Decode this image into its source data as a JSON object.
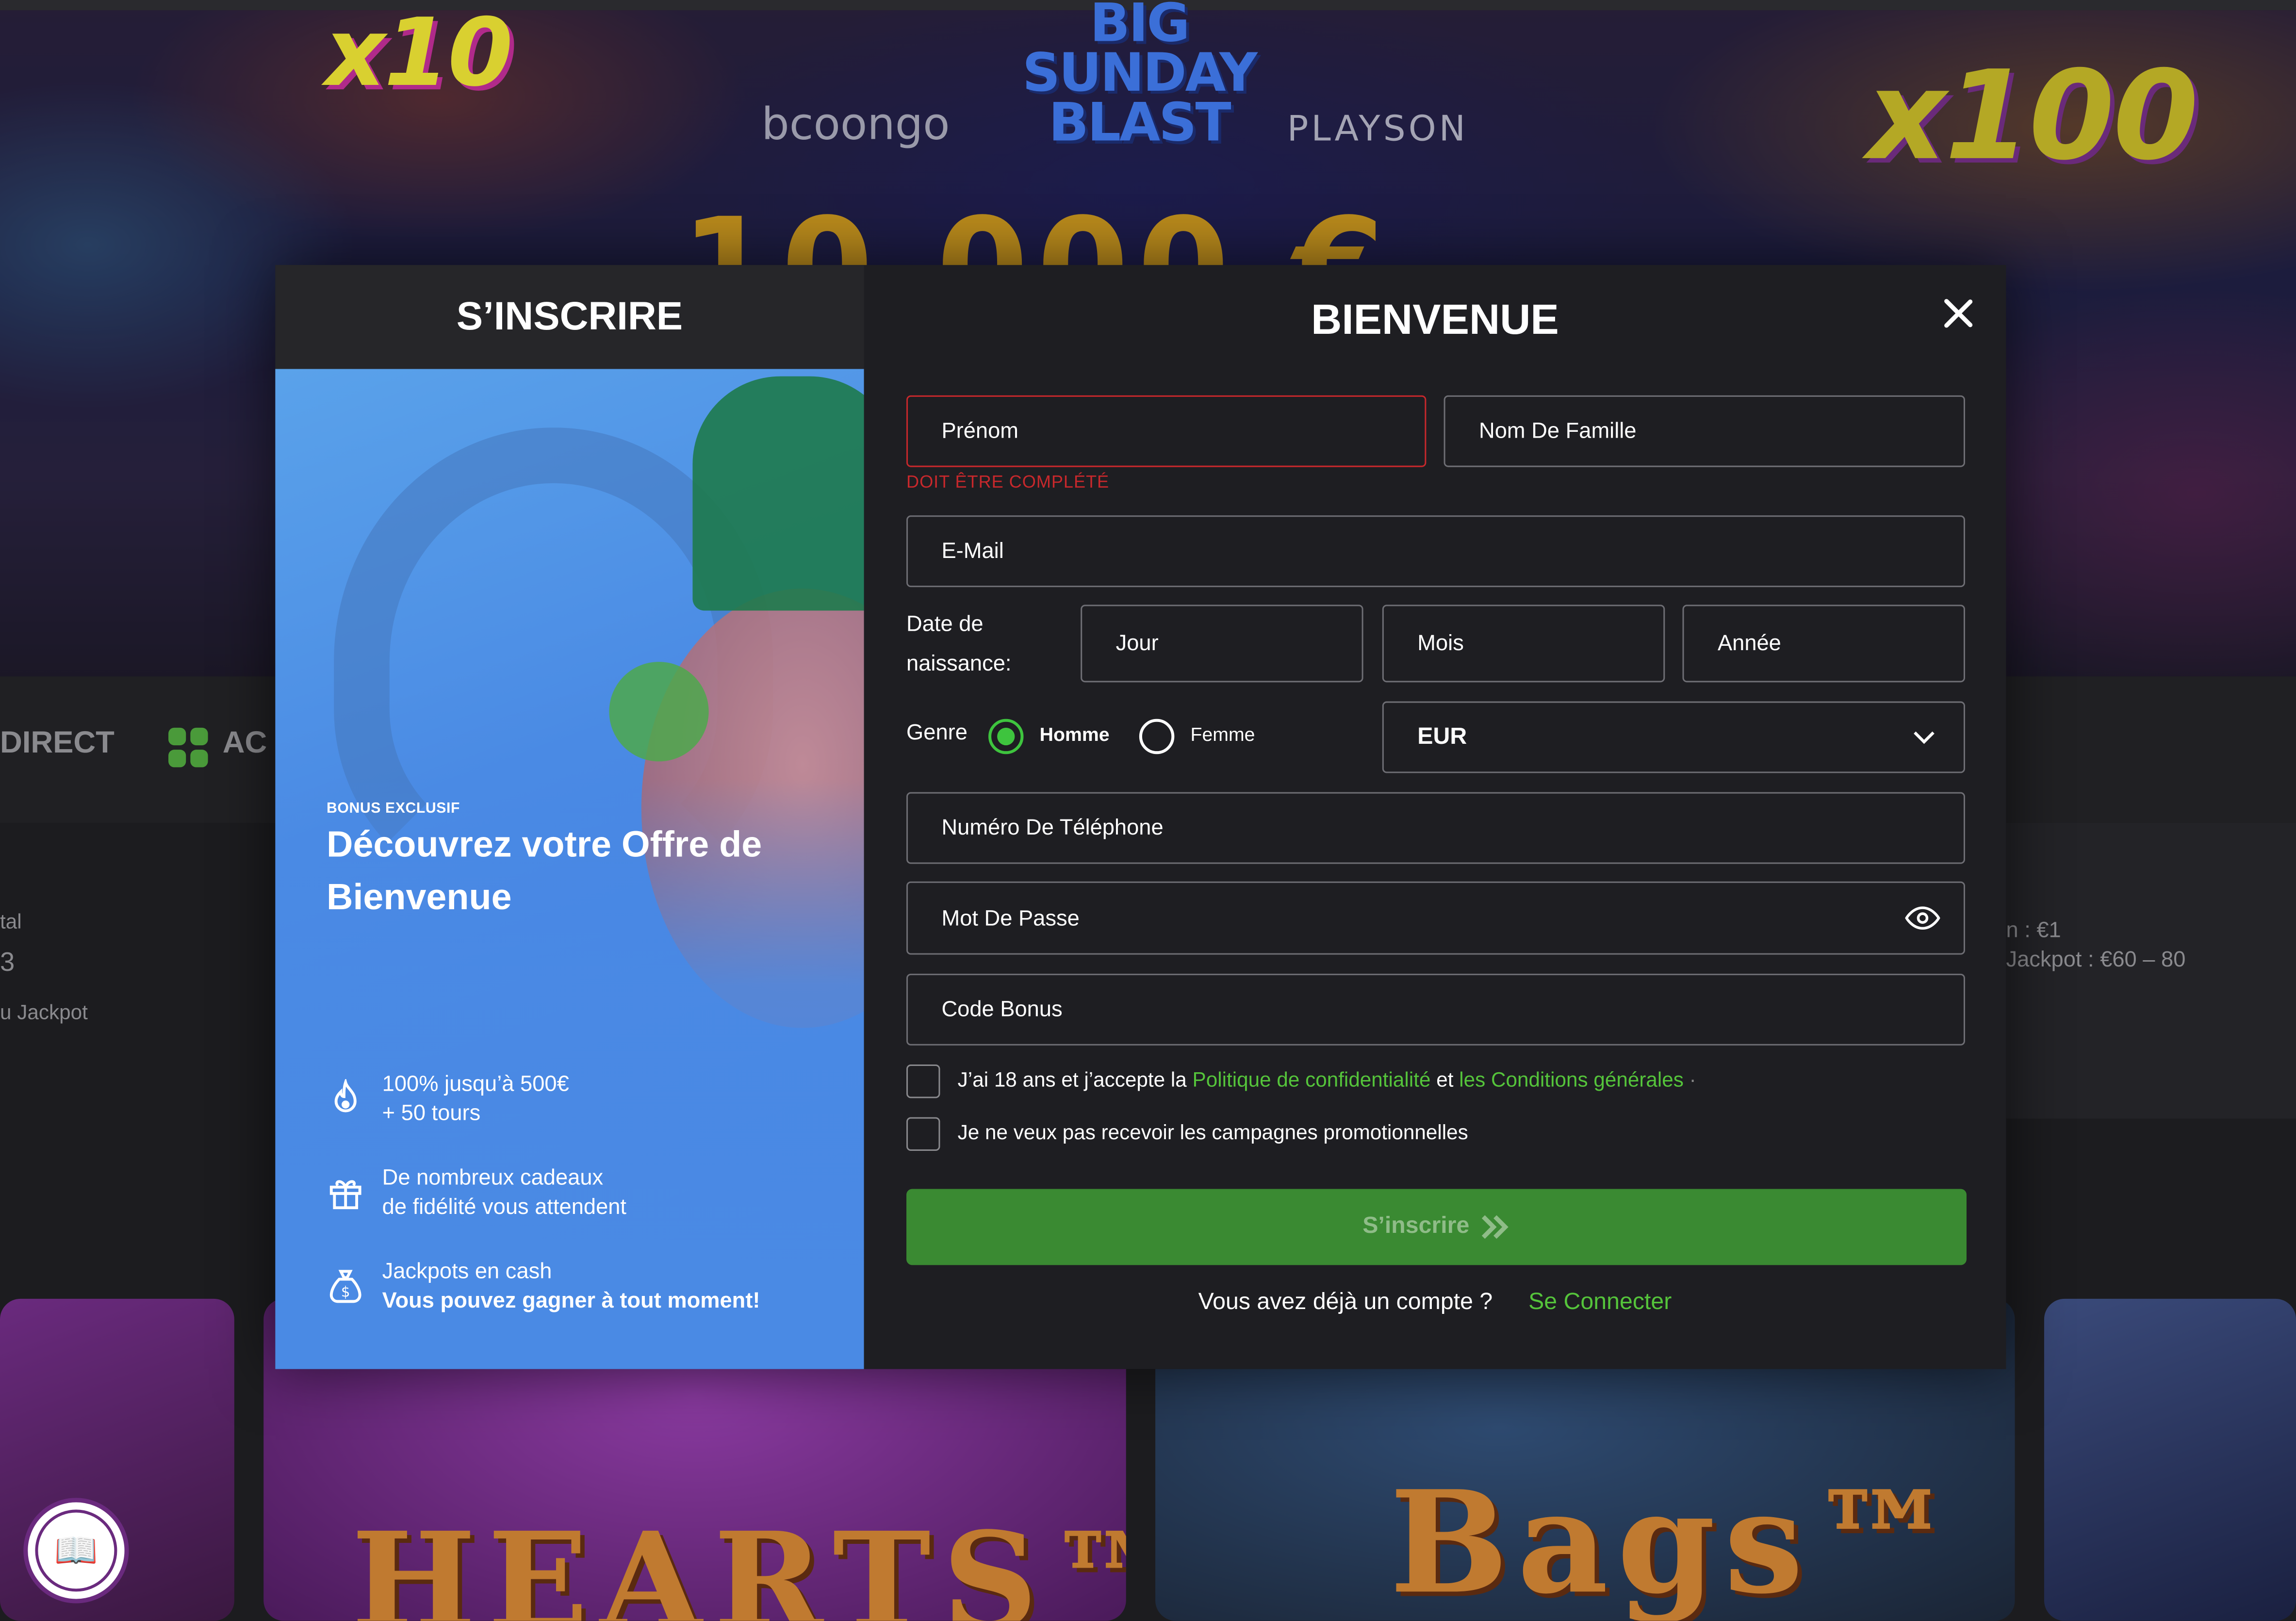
{
  "background": {
    "promo_x10": "x10",
    "promo_big_sunday": "BIG SUNDAY BLAST",
    "provider_1": "bcoongo",
    "provider_2": "PLAYSON",
    "promo_x100": "x100",
    "promo_amount": "10 000 €",
    "nav_direct": "DIRECT",
    "nav_ac": "AC",
    "jackpot_left_1": "tal",
    "jackpot_left_2": "3",
    "jackpot_left_3": "u Jackpot",
    "jackpot_right_1": "n : €1",
    "jackpot_right_2": "Jackpot : €60 – 80",
    "game_hearts": "HEARTS™",
    "game_bags": "Bags™",
    "badge_label": "BOOK OF BONUS"
  },
  "modal": {
    "tab_label": "S’INSCRIRE",
    "promo": {
      "kicker": "BONUS EXCLUSIF",
      "title": "Découvrez votre Offre de Bienvenue",
      "features": [
        {
          "icon": "flame-icon",
          "line1": "100% jusqu’à 500€",
          "line2": "+ 50 tours"
        },
        {
          "icon": "gift-icon",
          "line1": "De nombreux cadeaux",
          "line2": "de fidélité vous attendent"
        },
        {
          "icon": "money-bag-icon",
          "line1": "Jackpots en cash",
          "line2": "Vous pouvez gagner à tout moment!"
        }
      ]
    },
    "form": {
      "title": "BIENVENUE",
      "first_name_placeholder": "Prénom",
      "first_name_error": "DOIT ÊTRE COMPLÉTÉ",
      "last_name_placeholder": "Nom De Famille",
      "email_placeholder": "E-Mail",
      "dob_label": "Date de naissance:",
      "dob_day": "Jour",
      "dob_month": "Mois",
      "dob_year": "Année",
      "gender_label": "Genre",
      "gender_male": "Homme",
      "gender_female": "Femme",
      "gender_selected": "Homme",
      "currency": "EUR",
      "phone_placeholder": "Numéro De Téléphone",
      "password_placeholder": "Mot De Passe",
      "bonus_code_placeholder": "Code Bonus",
      "terms_prefix": "J’ai 18 ans et j’accepte la",
      "terms_privacy": "Politique de confidentialité",
      "terms_and": "et",
      "terms_conditions": "les Conditions générales",
      "terms_suffix": "·",
      "no_promo": "Je ne veux pas recevoir les campagnes promotionnelles",
      "submit_label": "S’inscrire",
      "have_account": "Vous avez déjà un compte ?",
      "login_link": "Se Connecter"
    }
  },
  "colors": {
    "accent_green": "#3a8a32",
    "link_green": "#55c43b",
    "error_red": "#c7282c",
    "promo_blue": "#4a8ae4"
  }
}
